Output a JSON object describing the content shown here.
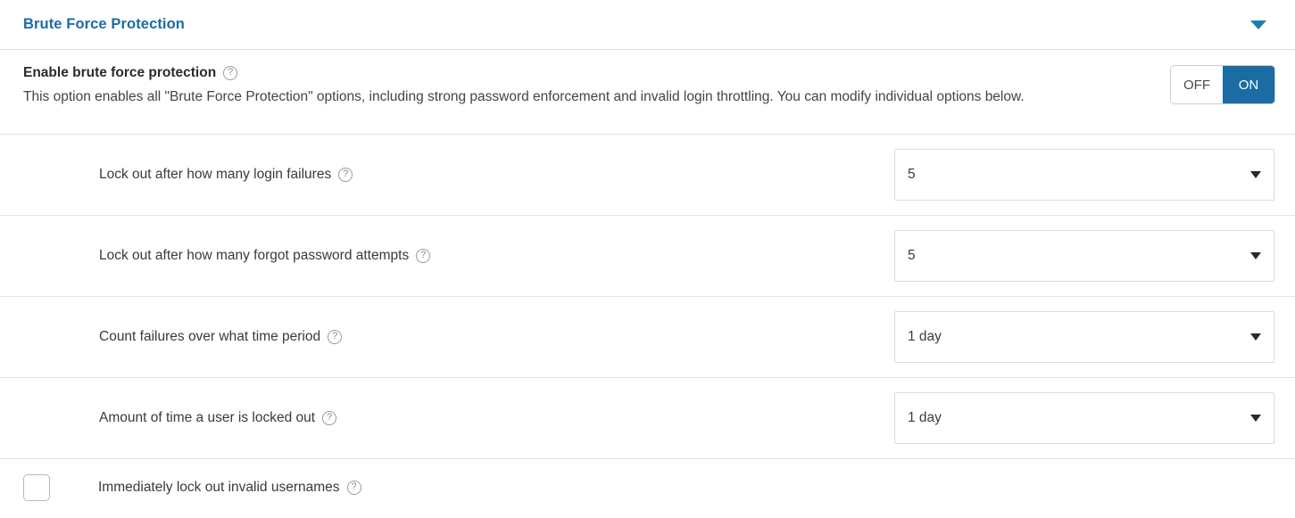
{
  "header": {
    "title": "Brute Force Protection",
    "collapse_icon": "caret-down-icon"
  },
  "enable_section": {
    "label": "Enable brute force protection",
    "help_icon": "help-circle-icon",
    "help_glyph": "?",
    "description": "This option enables all \"Brute Force Protection\" options, including strong password enforcement and invalid login throttling. You can modify individual options below.",
    "toggle": {
      "off_label": "OFF",
      "on_label": "ON",
      "selected": "ON"
    }
  },
  "settings": [
    {
      "label": "Lock out after how many login failures",
      "help_glyph": "?",
      "value": "5",
      "caret_icon": "caret-down-icon"
    },
    {
      "label": "Lock out after how many forgot password attempts",
      "help_glyph": "?",
      "value": "5",
      "caret_icon": "caret-down-icon"
    },
    {
      "label": "Count failures over what time period",
      "help_glyph": "?",
      "value": "1 day",
      "caret_icon": "caret-down-icon"
    },
    {
      "label": "Amount of time a user is locked out",
      "help_glyph": "?",
      "value": "1 day",
      "caret_icon": "caret-down-icon"
    }
  ],
  "checkbox_setting": {
    "label": "Immediately lock out invalid usernames",
    "help_glyph": "?",
    "checked": false
  },
  "colors": {
    "accent_blue": "#1b6ca3",
    "title_blue": "#1b6ca3",
    "border_gray": "#e2e2e2",
    "text_dark": "#333333",
    "help_gray": "#8d8d8d"
  }
}
